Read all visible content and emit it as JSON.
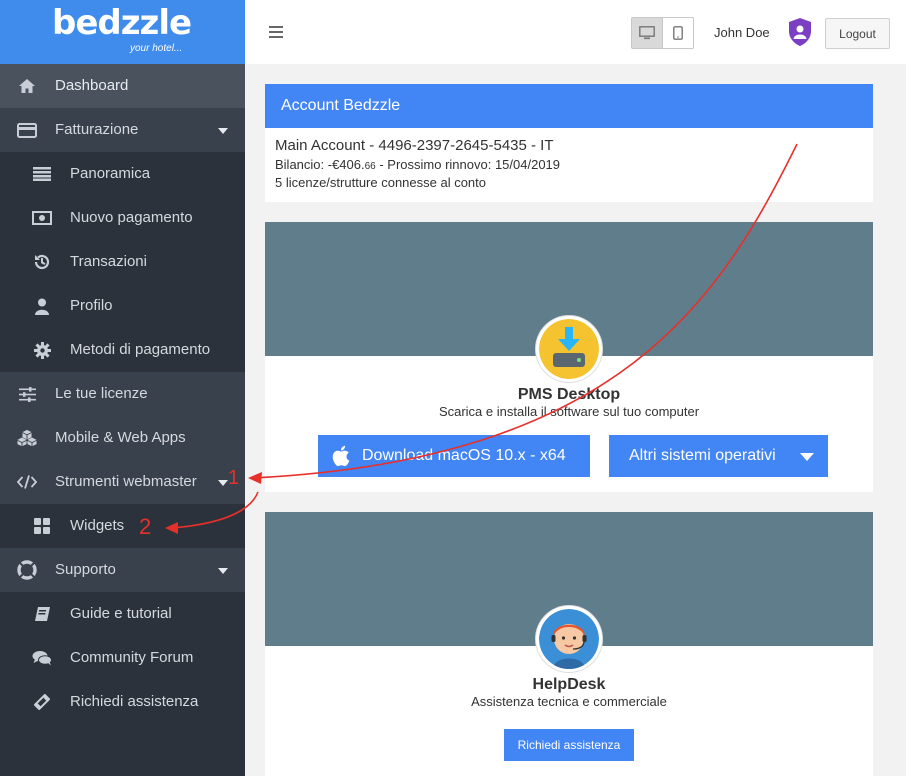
{
  "brand": {
    "logo_text": "bedzzle",
    "tagline": "your hotel..."
  },
  "sidebar": {
    "items": [
      {
        "label": "Dashboard",
        "icon": "home-icon"
      },
      {
        "label": "Fatturazione",
        "icon": "credit-card-icon"
      },
      {
        "label": "Panoramica",
        "icon": "list-icon"
      },
      {
        "label": "Nuovo pagamento",
        "icon": "money-icon"
      },
      {
        "label": "Transazioni",
        "icon": "history-icon"
      },
      {
        "label": "Profilo",
        "icon": "user-icon"
      },
      {
        "label": "Metodi di pagamento",
        "icon": "gear-icon"
      },
      {
        "label": "Le tue licenze",
        "icon": "sliders-icon"
      },
      {
        "label": "Mobile & Web Apps",
        "icon": "cubes-icon"
      },
      {
        "label": "Strumenti webmaster",
        "icon": "code-icon"
      },
      {
        "label": "Widgets",
        "icon": "widgets-icon"
      },
      {
        "label": "Supporto",
        "icon": "lifebuoy-icon"
      },
      {
        "label": "Guide e tutorial",
        "icon": "book-icon"
      },
      {
        "label": "Community Forum",
        "icon": "comments-icon"
      },
      {
        "label": "Richiedi assistenza",
        "icon": "ticket-icon"
      }
    ]
  },
  "header": {
    "user": "John Doe",
    "logout_label": "Logout"
  },
  "account": {
    "title": "Account Bedzzle",
    "main": "Main Account - 4496-2397-2645-5435 - IT",
    "balance_prefix": "Bilancio: -€406.",
    "balance_cents": "66",
    "renewal": " - Prossimo rinnovo: 15/04/2019",
    "licenses": "5 licenze/strutture connesse al conto"
  },
  "pms": {
    "title": "PMS Desktop",
    "subtitle": "Scarica e installa il software sul tuo computer",
    "download_label": "Download macOS 10.x - x64",
    "other_os_label": "Altri sistemi operativi"
  },
  "helpdesk": {
    "title": "HelpDesk",
    "subtitle": "Assistenza tecnica e commerciale",
    "button_label": "Richiedi assistenza"
  },
  "annotations": {
    "marker1": "1",
    "marker2": "2"
  },
  "colors": {
    "accent": "#4285f4",
    "sidebar": "#2c323b",
    "banner": "#607d8b",
    "annotation": "#e8302a"
  }
}
